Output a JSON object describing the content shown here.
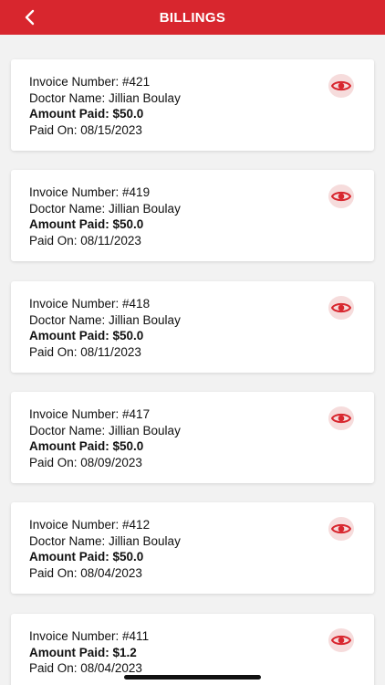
{
  "header": {
    "title": "BILLINGS",
    "back_icon": "chevron-left-icon",
    "bg_color": "#d8262e"
  },
  "invoices": [
    {
      "invoice": "Invoice Number: #421",
      "doctor": "Doctor Name: Jillian Boulay",
      "amount": "Amount Paid: $50.0",
      "paid_on": "Paid On: 08/15/2023"
    },
    {
      "invoice": "Invoice Number: #419",
      "doctor": "Doctor Name: Jillian Boulay",
      "amount": "Amount Paid: $50.0",
      "paid_on": "Paid On: 08/11/2023"
    },
    {
      "invoice": "Invoice Number: #418",
      "doctor": "Doctor Name: Jillian Boulay",
      "amount": "Amount Paid: $50.0",
      "paid_on": "Paid On: 08/11/2023"
    },
    {
      "invoice": "Invoice Number: #417",
      "doctor": "Doctor Name: Jillian Boulay",
      "amount": "Amount Paid: $50.0",
      "paid_on": "Paid On: 08/09/2023"
    },
    {
      "invoice": "Invoice Number: #412",
      "doctor": "Doctor Name: Jillian Boulay",
      "amount": "Amount Paid: $50.0",
      "paid_on": "Paid On: 08/04/2023"
    },
    {
      "invoice": "Invoice Number: #411",
      "amount": "Amount Paid: $1.2",
      "paid_on": "Paid On: 08/04/2023"
    }
  ],
  "icons": {
    "view": "eye-icon"
  },
  "colors": {
    "accent": "#d8262e",
    "eye_bg": "#f6dcdc"
  }
}
